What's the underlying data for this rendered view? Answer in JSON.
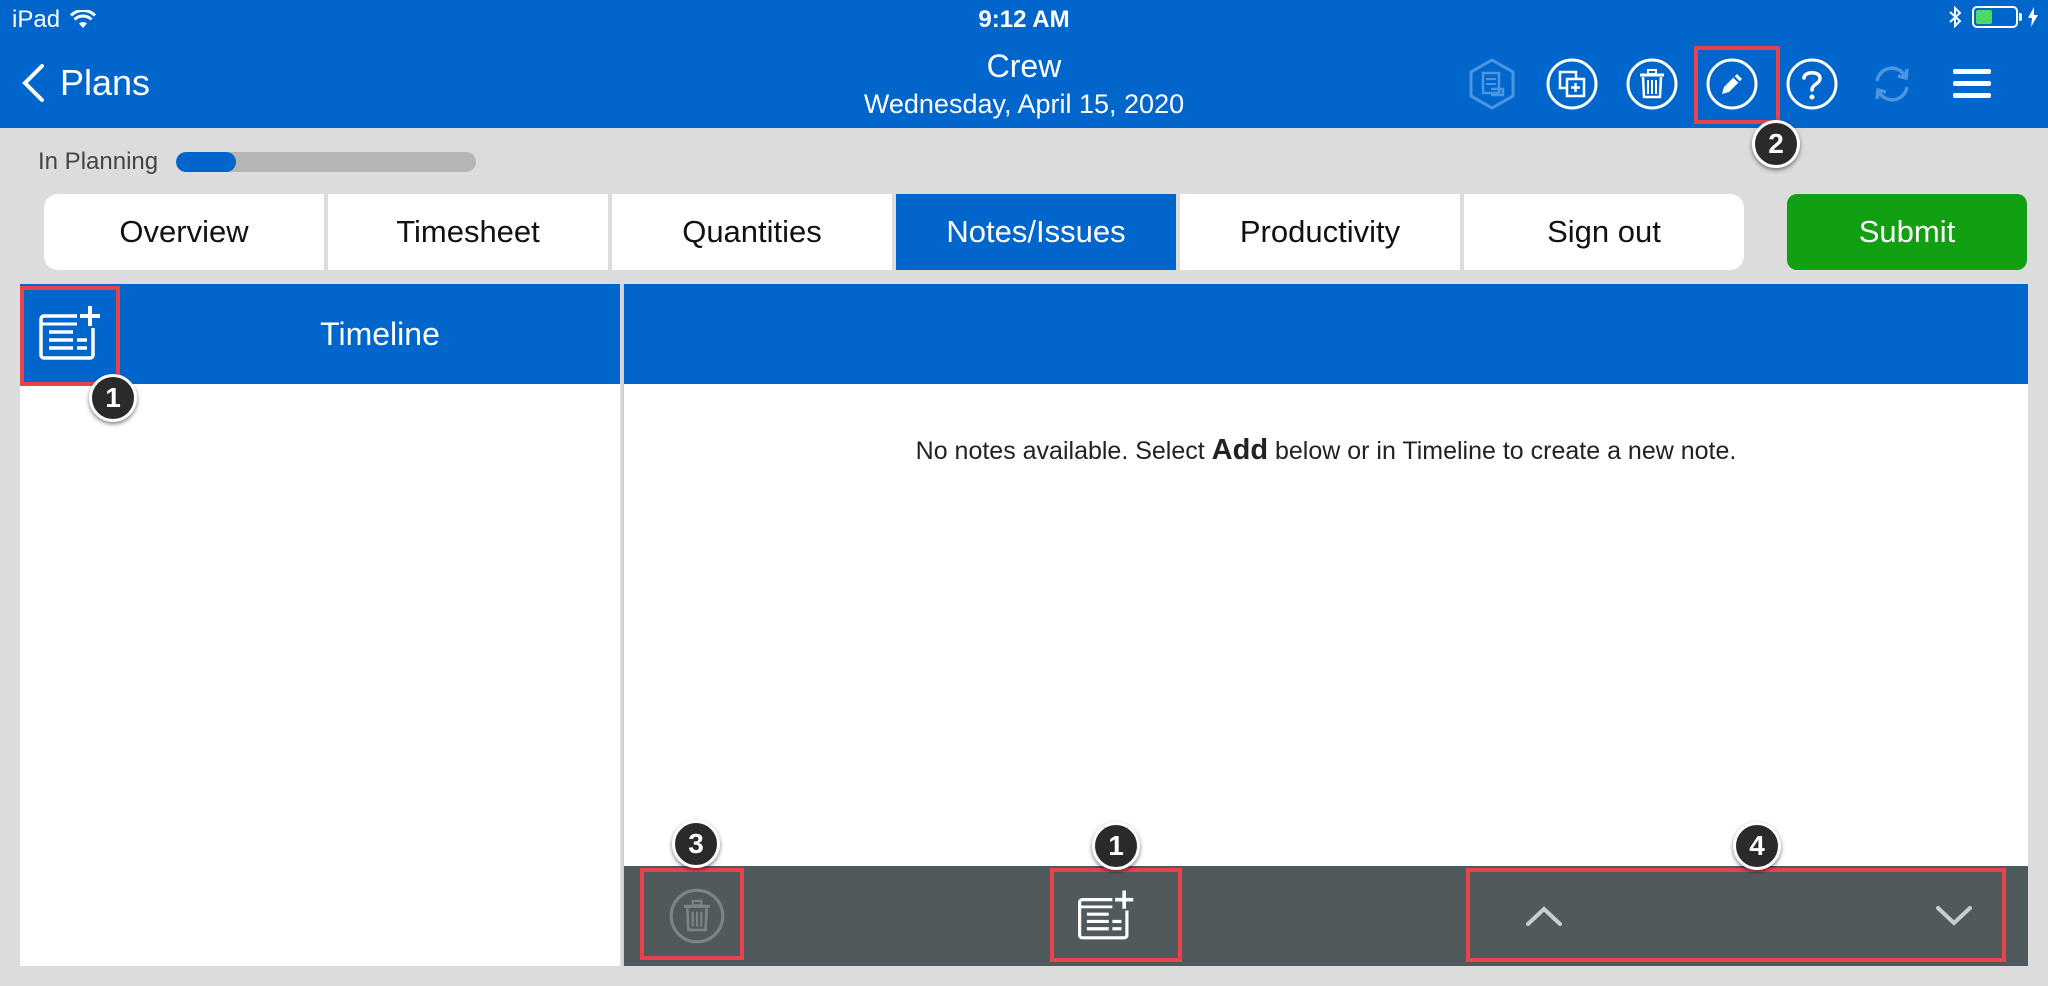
{
  "status_bar": {
    "carrier": "iPad",
    "time": "9:12 AM"
  },
  "header": {
    "back_label": "Plans",
    "title": "Crew",
    "subtitle": "Wednesday, April 15, 2020",
    "icons": [
      "report-icon",
      "copy-add-icon",
      "trash-icon",
      "edit-pencil-icon",
      "help-icon",
      "sync-icon",
      "menu-icon"
    ]
  },
  "progress": {
    "label": "In Planning",
    "value": 0.2
  },
  "tabs": [
    {
      "label": "Overview"
    },
    {
      "label": "Timesheet"
    },
    {
      "label": "Quantities"
    },
    {
      "label": "Notes/Issues",
      "active": true
    },
    {
      "label": "Productivity"
    },
    {
      "label": "Sign out"
    }
  ],
  "submit_label": "Submit",
  "left_panel": {
    "title": "Timeline"
  },
  "right_panel": {
    "empty_prefix": "No notes available. Select ",
    "empty_bold": "Add",
    "empty_suffix": " below or in Timeline to create a new note."
  },
  "annotations": {
    "badge_1": "1",
    "badge_2": "2",
    "badge_3": "3",
    "badge_4": "4"
  },
  "colors": {
    "primary": "#0066cc",
    "submit": "#10a011",
    "highlight": "#e8424d",
    "bottom_bar": "#505a5d"
  }
}
